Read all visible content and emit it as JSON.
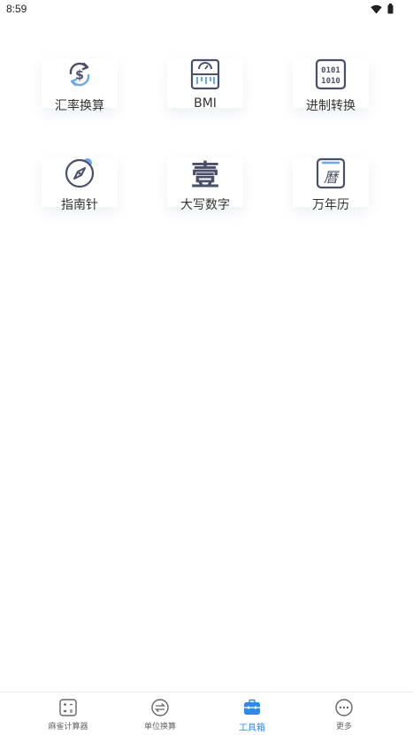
{
  "status_bar": {
    "time": "8:59"
  },
  "tools": [
    {
      "label": "汇率换算",
      "icon": "currency-exchange-icon"
    },
    {
      "label": "BMI",
      "icon": "scale-icon"
    },
    {
      "label": "进制转换",
      "icon": "binary-icon"
    },
    {
      "label": "指南针",
      "icon": "compass-icon"
    },
    {
      "label": "大写数字",
      "icon": "chinese-numeral-icon"
    },
    {
      "label": "万年历",
      "icon": "calendar-icon"
    }
  ],
  "icon_glyphs": {
    "numeral": "壹",
    "calendar": "曆"
  },
  "bottom_nav": [
    {
      "label": "麻雀计算器",
      "icon": "calculator-icon",
      "active": false
    },
    {
      "label": "单位换算",
      "icon": "unit-convert-icon",
      "active": false
    },
    {
      "label": "工具箱",
      "icon": "toolbox-icon",
      "active": true
    },
    {
      "label": "更多",
      "icon": "more-icon",
      "active": false
    }
  ],
  "colors": {
    "icon_stroke": "#4a4f6a",
    "accent": "#2f8bea",
    "accent_light": "#6aa8ee"
  }
}
